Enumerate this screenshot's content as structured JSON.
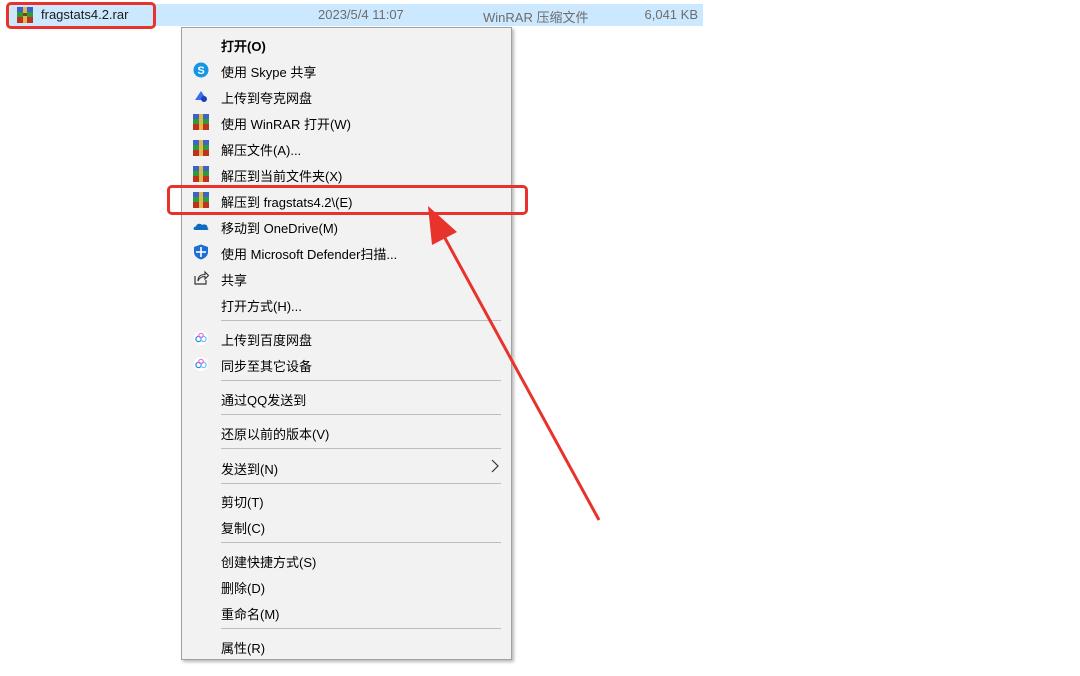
{
  "file": {
    "name": "fragstats4.2.rar",
    "modified": "2023/5/4 11:07",
    "type": "WinRAR 压缩文件",
    "size": "6,041 KB",
    "icon": "winrar-archive-icon"
  },
  "menu": {
    "items": [
      {
        "label": "打开(O)",
        "icon": ""
      },
      {
        "label": "使用 Skype 共享",
        "icon": "skype-icon"
      },
      {
        "label": "上传到夸克网盘",
        "icon": "quark-cloud-icon"
      },
      {
        "label": "使用 WinRAR 打开(W)",
        "icon": "winrar-icon"
      },
      {
        "label": "解压文件(A)...",
        "icon": "winrar-icon"
      },
      {
        "label": "解压到当前文件夹(X)",
        "icon": "winrar-icon"
      },
      {
        "label": "解压到 fragstats4.2\\(E)",
        "icon": "winrar-icon"
      },
      {
        "label": "移动到 OneDrive(M)",
        "icon": "onedrive-icon"
      },
      {
        "label": "使用 Microsoft Defender扫描...",
        "icon": "defender-shield-icon"
      },
      {
        "label": "共享",
        "icon": "share-icon"
      },
      {
        "label": "打开方式(H)...",
        "icon": ""
      },
      {
        "label": "上传到百度网盘",
        "icon": "baidu-netdisk-icon"
      },
      {
        "label": "同步至其它设备",
        "icon": "baidu-netdisk-icon"
      },
      {
        "label": "通过QQ发送到",
        "icon": ""
      },
      {
        "label": "还原以前的版本(V)",
        "icon": ""
      },
      {
        "label": "发送到(N)",
        "icon": "",
        "submenu": true
      },
      {
        "label": "剪切(T)",
        "icon": ""
      },
      {
        "label": "复制(C)",
        "icon": ""
      },
      {
        "label": "创建快捷方式(S)",
        "icon": ""
      },
      {
        "label": "删除(D)",
        "icon": ""
      },
      {
        "label": "重命名(M)",
        "icon": ""
      },
      {
        "label": "属性(R)",
        "icon": ""
      }
    ]
  },
  "colors": {
    "selection": "#cce8ff",
    "menu_bg": "#f2f2f2",
    "annotation": "#e8322c"
  }
}
